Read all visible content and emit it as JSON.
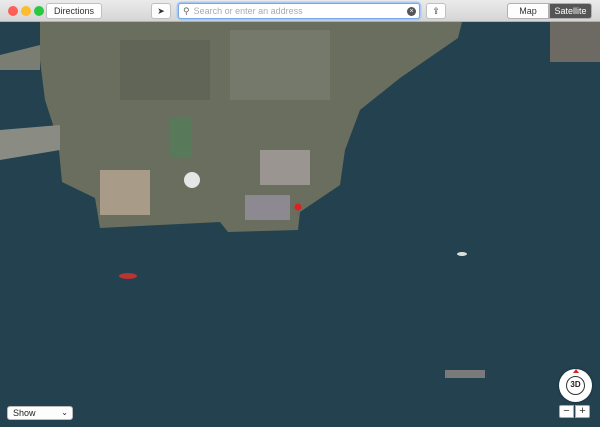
{
  "toolbar": {
    "directions_label": "Directions",
    "search_placeholder": "Search or enter an address",
    "map_label": "Map",
    "satellite_label": "Satellite"
  },
  "controls": {
    "show_label": "Show",
    "compass_label": "3D",
    "zoom_out_label": "−",
    "zoom_in_label": "+"
  },
  "colors": {
    "water": "#23414f",
    "land": "#6e7262",
    "pin": "#e02020"
  }
}
